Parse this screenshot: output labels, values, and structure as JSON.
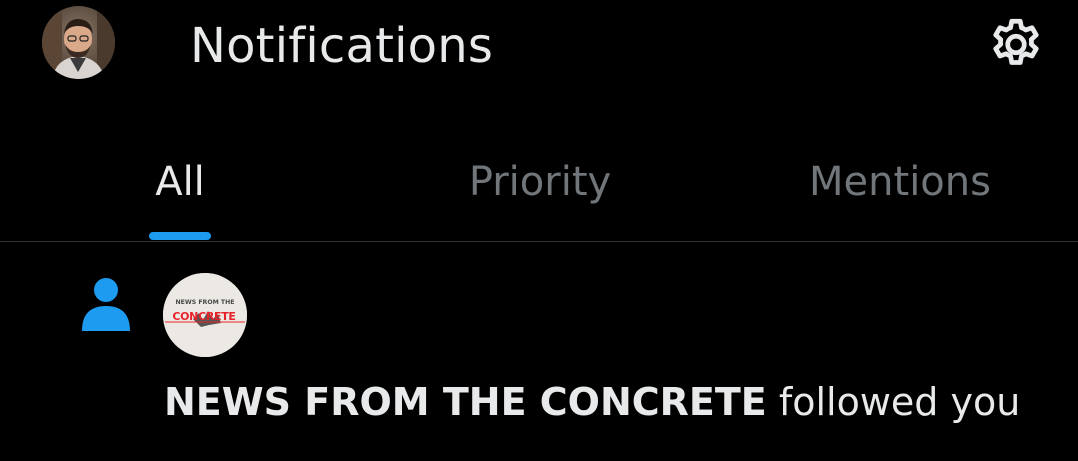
{
  "header": {
    "title": "Notifications",
    "avatar_icon": "user-profile-photo",
    "settings_icon": "gear-icon"
  },
  "tabs": [
    {
      "label": "All",
      "active": true
    },
    {
      "label": "Priority",
      "active": false
    },
    {
      "label": "Mentions",
      "active": false
    }
  ],
  "notifications": [
    {
      "type_icon": "person-icon",
      "actor_avatar_logo_text": "NEWS FROM THE CONCRETE",
      "actor": "NEWS FROM THE CONCRETE",
      "action": "followed you"
    }
  ],
  "colors": {
    "background": "#000000",
    "text_primary": "#e7e9ea",
    "text_secondary": "#71767b",
    "accent": "#1d9bf0",
    "divider": "#2f3336"
  }
}
